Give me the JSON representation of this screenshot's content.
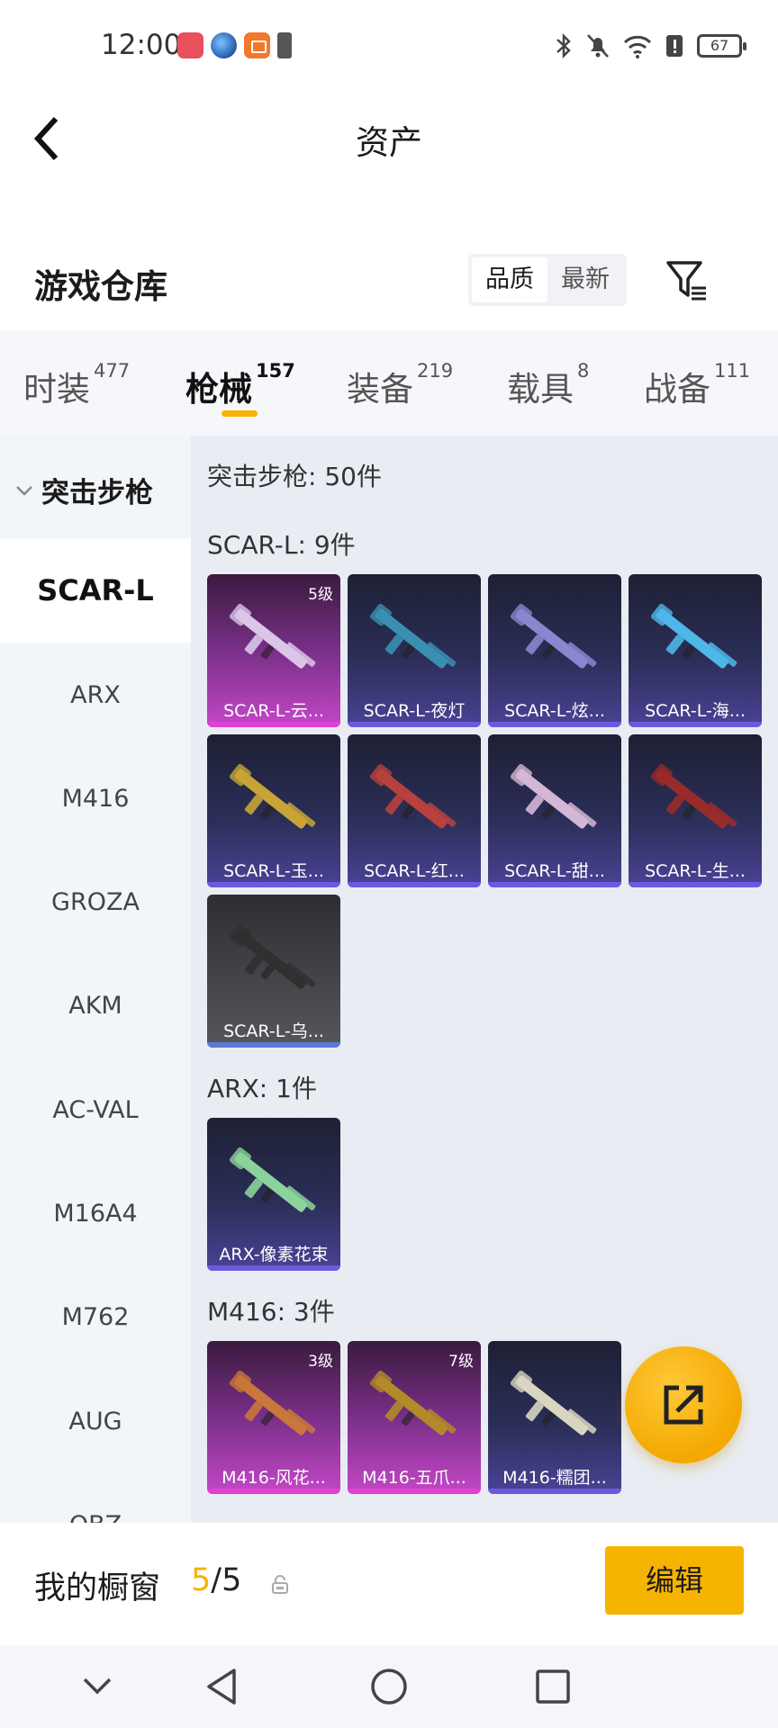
{
  "status_bar": {
    "time": "12:00",
    "battery": "67"
  },
  "header": {
    "title": "资产"
  },
  "warehouse": {
    "title": "游戏仓库",
    "sort_options": [
      "品质",
      "最新"
    ],
    "sort_selected": "品质"
  },
  "tabs": [
    {
      "label": "时装",
      "count": "477"
    },
    {
      "label": "枪械",
      "count": "157",
      "active": true
    },
    {
      "label": "装备",
      "count": "219"
    },
    {
      "label": "载具",
      "count": "8"
    },
    {
      "label": "战备",
      "count": "111"
    }
  ],
  "sidebar": {
    "group": "突击步枪",
    "items": [
      "SCAR-L",
      "ARX",
      "M416",
      "GROZA",
      "AKM",
      "AC-VAL",
      "M16A4",
      "M762",
      "AUG",
      "QBZ"
    ],
    "selected": "SCAR-L"
  },
  "content": {
    "category_total": "突击步枪: 50件",
    "sections": [
      {
        "header": "SCAR-L: 9件",
        "items": [
          {
            "name": "SCAR-L-云...",
            "level": "5级",
            "rarity": "pink"
          },
          {
            "name": "SCAR-L-夜灯",
            "rarity": "purple"
          },
          {
            "name": "SCAR-L-炫...",
            "rarity": "purple"
          },
          {
            "name": "SCAR-L-海...",
            "rarity": "purple"
          },
          {
            "name": "SCAR-L-玉...",
            "rarity": "purple"
          },
          {
            "name": "SCAR-L-红...",
            "rarity": "purple"
          },
          {
            "name": "SCAR-L-甜...",
            "rarity": "purple"
          },
          {
            "name": "SCAR-L-生...",
            "rarity": "purple"
          },
          {
            "name": "SCAR-L-乌...",
            "rarity": "grey"
          }
        ]
      },
      {
        "header": "ARX: 1件",
        "items": [
          {
            "name": "ARX-像素花束",
            "rarity": "purple"
          }
        ]
      },
      {
        "header": "M416: 3件",
        "items": [
          {
            "name": "M416-风花...",
            "level": "3级",
            "rarity": "pink"
          },
          {
            "name": "M416-五爪...",
            "level": "7级",
            "rarity": "pink"
          },
          {
            "name": "M416-糯团...",
            "rarity": "purple"
          }
        ]
      }
    ]
  },
  "showcase": {
    "label": "我的橱窗",
    "current": "5",
    "separator": "/",
    "total": "5",
    "edit_label": "编辑"
  },
  "colors": {
    "accent": "#f6b400",
    "rarity_pink": "#e23fd6",
    "rarity_purple": "#6a5ae0",
    "rarity_grey": "#5a78d8"
  }
}
